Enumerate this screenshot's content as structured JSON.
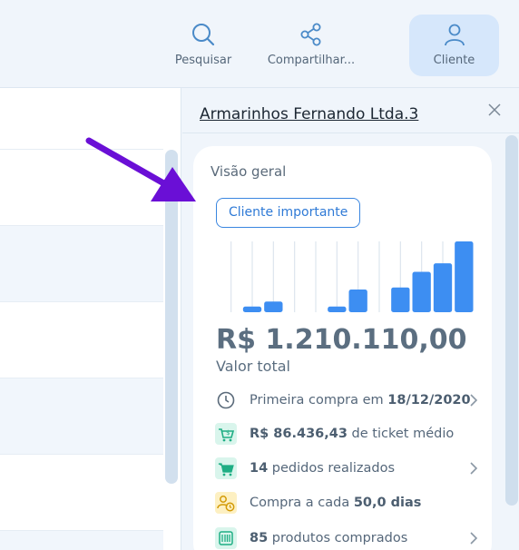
{
  "toolbar": {
    "search_label": "Pesquisar",
    "share_label": "Compartilhar...",
    "client_label": "Cliente"
  },
  "panel": {
    "title": "Armarinhos Fernando Ltda.3",
    "overview_title": "Visão geral",
    "badge": "Cliente importante",
    "total_value": "R$ 1.210.110,00",
    "total_label": "Valor total",
    "stats": {
      "first_purchase_prefix": "Primeira compra em ",
      "first_purchase_date": "18/12/2020",
      "ticket_value": "R$ 86.436,43",
      "ticket_suffix": " de ticket médio",
      "orders_count": "14",
      "orders_suffix": " pedidos realizados",
      "frequency_prefix": "Compra a cada ",
      "frequency_value": "50,0 dias",
      "products_count": "85",
      "products_suffix": " produtos comprados"
    }
  },
  "sparkline": {
    "values": [
      0,
      0.08,
      0.15,
      0,
      0,
      0.08,
      0.32,
      0,
      0.35,
      0.57,
      0.69,
      1.0
    ],
    "color": "#3d8ef2",
    "gridline_color": "#dde5ee"
  },
  "colors": {
    "accent": "#3a86e0",
    "arrow": "#6a0fd6",
    "icon_green_bg": "#d9f5ec",
    "icon_yellow_bg": "#fdf0c2"
  }
}
